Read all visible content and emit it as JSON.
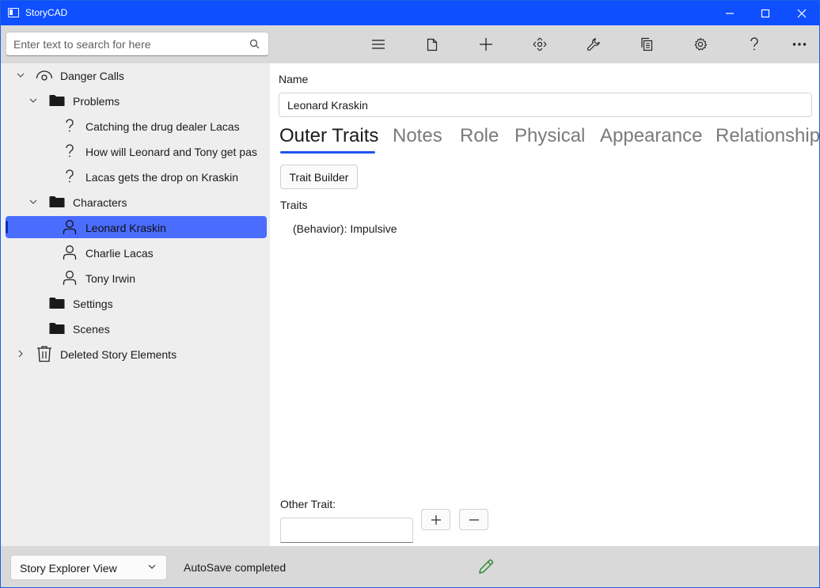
{
  "window": {
    "title": "StoryCAD"
  },
  "search": {
    "placeholder": "Enter text to search for here"
  },
  "toolbar": {
    "buttons": [
      "menu-icon",
      "new-file-icon",
      "add-icon",
      "navigate-icon",
      "wrench-icon",
      "copy-icon",
      "gear-icon",
      "help-icon",
      "more-icon"
    ]
  },
  "tree": {
    "root": "Danger Calls",
    "problems_folder": "Problems",
    "problems": [
      "Catching the drug dealer Lacas",
      "How will Leonard and Tony get pas",
      "Lacas gets the drop on Kraskin"
    ],
    "characters_folder": "Characters",
    "characters": [
      "Leonard Kraskin",
      "Charlie Lacas",
      "Tony Irwin"
    ],
    "settings_folder": "Settings",
    "scenes_folder": "Scenes",
    "trash": "Deleted Story Elements"
  },
  "colors": {
    "title_bar": "#0e4fff",
    "selection": "#4a6cff",
    "tab_underline": "#1f55f0",
    "status_pencil": "#2e8b2e"
  },
  "form": {
    "name_label": "Name",
    "name_value": "Leonard Kraskin",
    "tabs": [
      "Outer Traits",
      "Notes",
      "Role",
      "Physical",
      "Appearance",
      "Relationships"
    ],
    "active_tab": "Outer Traits",
    "trait_builder_label": "Trait Builder",
    "traits_label": "Traits",
    "traits": [
      "(Behavior): Impulsive"
    ],
    "other_trait_label": "Other Trait:",
    "other_trait_value": ""
  },
  "status": {
    "view_selected": "Story Explorer View",
    "message": "AutoSave completed"
  }
}
